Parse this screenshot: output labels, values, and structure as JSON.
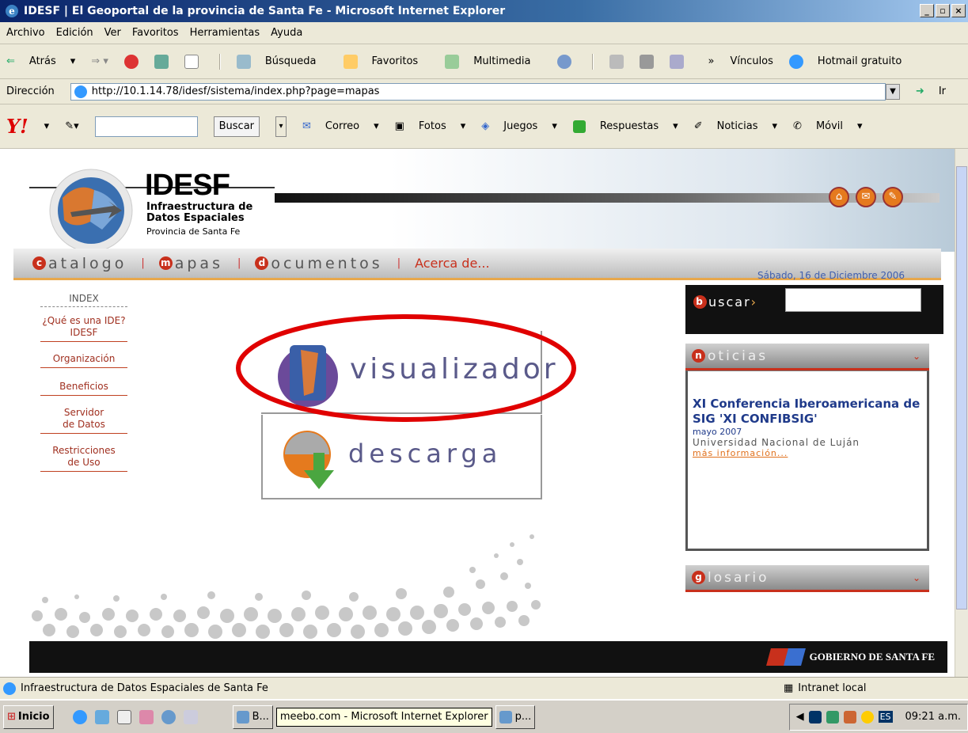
{
  "window": {
    "title": "IDESF | El Geoportal de la provincia de Santa Fe - Microsoft Internet Explorer"
  },
  "menubar": {
    "items": [
      "Archivo",
      "Edición",
      "Ver",
      "Favoritos",
      "Herramientas",
      "Ayuda"
    ]
  },
  "toolbar": {
    "back": "Atrás",
    "search": "Búsqueda",
    "favorites": "Favoritos",
    "multimedia": "Multimedia",
    "links": "Vínculos",
    "hotmail": "Hotmail gratuito"
  },
  "address": {
    "label": "Dirección",
    "url": "http://10.1.14.78/idesf/sistema/index.php?page=mapas",
    "go": "Ir"
  },
  "yahoo": {
    "search_button": "Buscar",
    "correo": "Correo",
    "fotos": "Fotos",
    "juegos": "Juegos",
    "respuestas": "Respuestas",
    "noticias": "Noticias",
    "movil": "Móvil"
  },
  "site": {
    "logo_title": "IDESF",
    "logo_line1": "Infraestructura de",
    "logo_line2": "Datos Espaciales",
    "logo_line3": "Provincia de Santa Fe",
    "nav": {
      "catalogo": "atalogo",
      "mapas": "apas",
      "documentos": "ocumentos",
      "acerca": "Acerca de..."
    },
    "date": "Sábado, 16 de Diciembre 2006",
    "index_title": "INDEX",
    "sidebar": [
      "¿Qué es una IDE? IDESF",
      "Organización",
      "Beneficios",
      "Servidor de Datos",
      "Restricciones de Uso"
    ],
    "visualizador": "visualizador",
    "descarga": "descarga",
    "buscar_label": "uscar",
    "noticias_title": "oticias",
    "news_headline": "XI Conferencia Iberoamericana de SIG 'XI CONFIBSIG'",
    "news_date": "mayo 2007",
    "news_org": "Universidad Nacional de Luján",
    "news_more": "más información...",
    "glosario_title": "losario",
    "footer": "GOBIERNO DE SANTA FE"
  },
  "status": {
    "text": "Infraestructura de Datos Espaciales de Santa Fe",
    "zone": "Intranet local"
  },
  "taskbar": {
    "start": "Inicio",
    "task1": "B...",
    "tooltip": "meebo.com - Microsoft Internet Explorer",
    "task2": "p...",
    "lang": "ES",
    "time": "09:21 a.m."
  },
  "colors": {
    "accent": "#c8301c",
    "annotation": "#e00000"
  }
}
